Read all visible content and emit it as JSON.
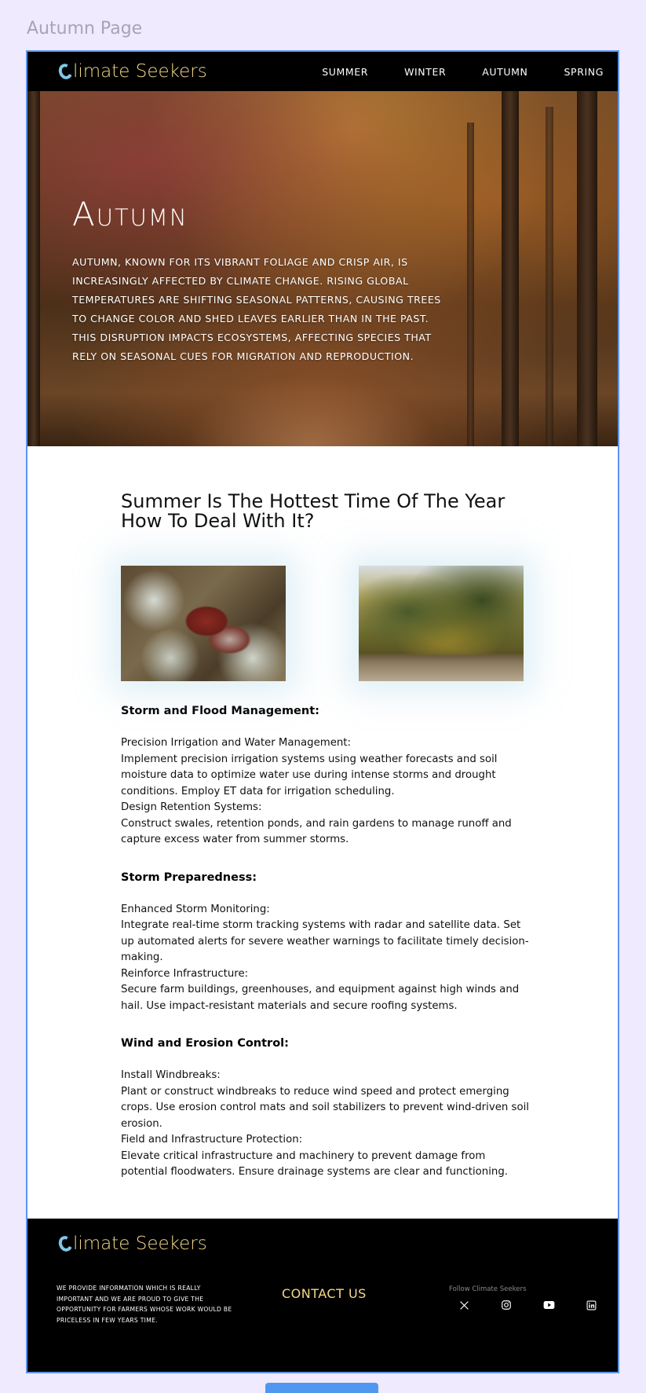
{
  "canvas": {
    "label": "Autumn Page"
  },
  "nav": {
    "brand": "limate Seekers",
    "links": [
      "SUMMER",
      "WINTER",
      "AUTUMN",
      "SPRING"
    ]
  },
  "hero": {
    "title": "Autumn",
    "text": "Autumn, known for its vibrant foliage and crisp air, is increasingly affected by climate change. Rising global temperatures are shifting seasonal patterns, causing trees to change color and shed leaves earlier than in the past. This disruption impacts ecosystems, affecting species that rely on seasonal cues for migration and reproduction."
  },
  "main": {
    "title": "Summer Is The Hottest Time Of The Year How To Deal With It?",
    "images": [
      "mushroom-photo",
      "autumn-park-photo"
    ],
    "sections": [
      {
        "heading": "Storm and Flood Management:",
        "paragraphs": [
          "Precision Irrigation and Water Management:",
          "Implement precision irrigation systems using weather forecasts and soil moisture data to optimize water use during intense storms and drought conditions. Employ ET data for irrigation scheduling.",
          "Design Retention Systems:",
          "Construct swales, retention ponds, and rain gardens to manage runoff and capture excess water from summer storms."
        ]
      },
      {
        "heading": "Storm Preparedness:",
        "paragraphs": [
          "Enhanced Storm Monitoring:",
          "Integrate real-time storm tracking systems with radar and satellite data. Set up automated alerts for severe weather warnings to facilitate timely decision-making.",
          "Reinforce Infrastructure:",
          "Secure farm buildings, greenhouses, and equipment against high winds and hail. Use impact-resistant materials and secure roofing systems."
        ]
      },
      {
        "heading": "Wind and Erosion Control:",
        "paragraphs": [
          "Install Windbreaks:",
          "Plant or construct windbreaks to reduce wind speed and protect emerging crops. Use erosion control mats and soil stabilizers to prevent wind-driven soil erosion.",
          "Field and Infrastructure Protection:",
          "Elevate critical infrastructure and machinery to prevent damage from potential floodwaters. Ensure drainage systems are clear and functioning."
        ]
      }
    ]
  },
  "footer": {
    "brand": "limate Seekers",
    "about": "We provide information which is really important and we are proud to give the opportunity for farmers whose work would be priceless in few years time.",
    "contact": "CONTACT US",
    "follow": "Follow Climate Seekers",
    "socials": [
      "x-icon",
      "instagram-icon",
      "youtube-icon",
      "linkedin-icon"
    ]
  },
  "colors": {
    "accent_gold": "#f4d98a",
    "logo_blue": "#7ec7e8",
    "frame_border": "#5a94f0",
    "canvas_bg": "#efeafd"
  }
}
